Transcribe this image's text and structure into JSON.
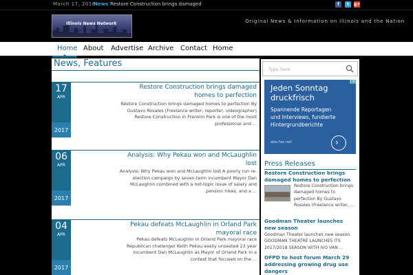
{
  "topbar": {
    "date": "March 17, 2018",
    "news_label": "News",
    "ticker": "Restore Construction brings damaged",
    "social": [
      {
        "name": "facebook",
        "glyph": "f",
        "color": "#3b5998"
      },
      {
        "name": "twitter",
        "glyph": "t",
        "color": "#2aa3d8"
      },
      {
        "name": "google-plus",
        "glyph": "g+",
        "color": "#d9452f"
      }
    ]
  },
  "header": {
    "logo_text": "Illinois News Network",
    "tagline": "Original News & Information on Illinois and the Nation"
  },
  "nav": {
    "items": [
      {
        "label": "Home",
        "active": true
      },
      {
        "label": "About"
      },
      {
        "label": "Advertise"
      },
      {
        "label": "Archive"
      },
      {
        "label": "Contact"
      },
      {
        "label": "Home"
      }
    ]
  },
  "main": {
    "section_title": "News, Features",
    "articles": [
      {
        "day": "17",
        "month": "APR",
        "year": "2017",
        "title": "Restore Construction brings damaged homes to perfection",
        "excerpt": "Restore Construction brings damaged homes to perfection By Gustavo Rosales (Freelance writer, reporter, videographer) Restore Construction in Franklin Park is one of the most professional and ..."
      },
      {
        "day": "06",
        "month": "APR",
        "year": "2017",
        "title": "Analysis: Why Pekau won and McLaughlin lost",
        "excerpt": "Analysis: Why Pekau won and McLaughlin lost A poorly run re-election campaign by seven-term incumbent Mayor Dan McLaughlin combined with a hot-topic issue of salary and pension hikes, and a ..."
      },
      {
        "day": "04",
        "month": "APR",
        "year": "2017",
        "title": "Pekau defeats McLaughlin in Orland Park mayoral race",
        "excerpt": "Pekau defeats McLaughlin in Orland Park mayoral race Republican challenger Keith Pekau easily unseated 23 year incumbent Dan McLaughlin as Mayor of Orland Park in a contest that focused on the ..."
      }
    ]
  },
  "sidebar": {
    "search_placeholder": "Type here",
    "ad": {
      "headline_1": "Jeden Sonntag",
      "headline_2": "druckfrisch",
      "sub_1": "Spannende Reportagen",
      "sub_2": "und Interviews, fundierte",
      "sub_3": "Hintergrundberichte",
      "url": "abo.faz.net",
      "badge": "i ✕"
    },
    "press_title": "Press Releases",
    "press": [
      {
        "title": "Restore Construction brings damaged homes to perfection",
        "excerpt": "Restore Construction brings damaged homes to perfection By Gustavo Rosales (Freelance writer, ..."
      },
      {
        "title": "Goodman Theater launches new season",
        "excerpt": "Goodman Theater launches new season GOODMAN THEATRE LAUNCHES ITS 2017/2018 SEASON WITH IVO VAN ..."
      },
      {
        "title": "OFPD to host forum March 29 addressing growing drug use dangers",
        "excerpt": ""
      }
    ]
  }
}
